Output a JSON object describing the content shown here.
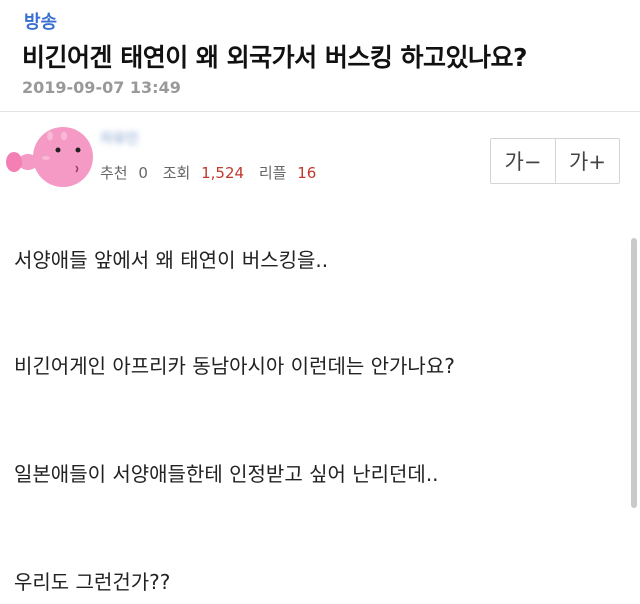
{
  "post": {
    "category": "방송",
    "title": "비긴어겐 태연이 왜 외국가서 버스킹 하고있나요?",
    "date": "2019-09-07 13:49"
  },
  "author": {
    "nickname": "자유인"
  },
  "stats": {
    "recommend_label": "추천",
    "recommend_value": "0",
    "views_label": "조회",
    "views_value": "1,524",
    "replies_label": "리플",
    "replies_value": "16"
  },
  "font_controls": {
    "decrease_label": "가−",
    "increase_label": "가+"
  },
  "content": {
    "lines": [
      "서양애들 앞에서 왜 태연이 버스킹을..",
      "비긴어게인 아프리카 동남아시아 이런데는 안가나요?",
      "일본애들이 서양애들한테 인정받고 싶어 난리던데..",
      "우리도 그런건가??"
    ]
  },
  "colors": {
    "category": "#3a6fd0",
    "accent_red": "#c0392b",
    "avatar_pink": "#f59ac4"
  },
  "icons": {
    "avatar": "pink-blob-avatar-icon"
  }
}
